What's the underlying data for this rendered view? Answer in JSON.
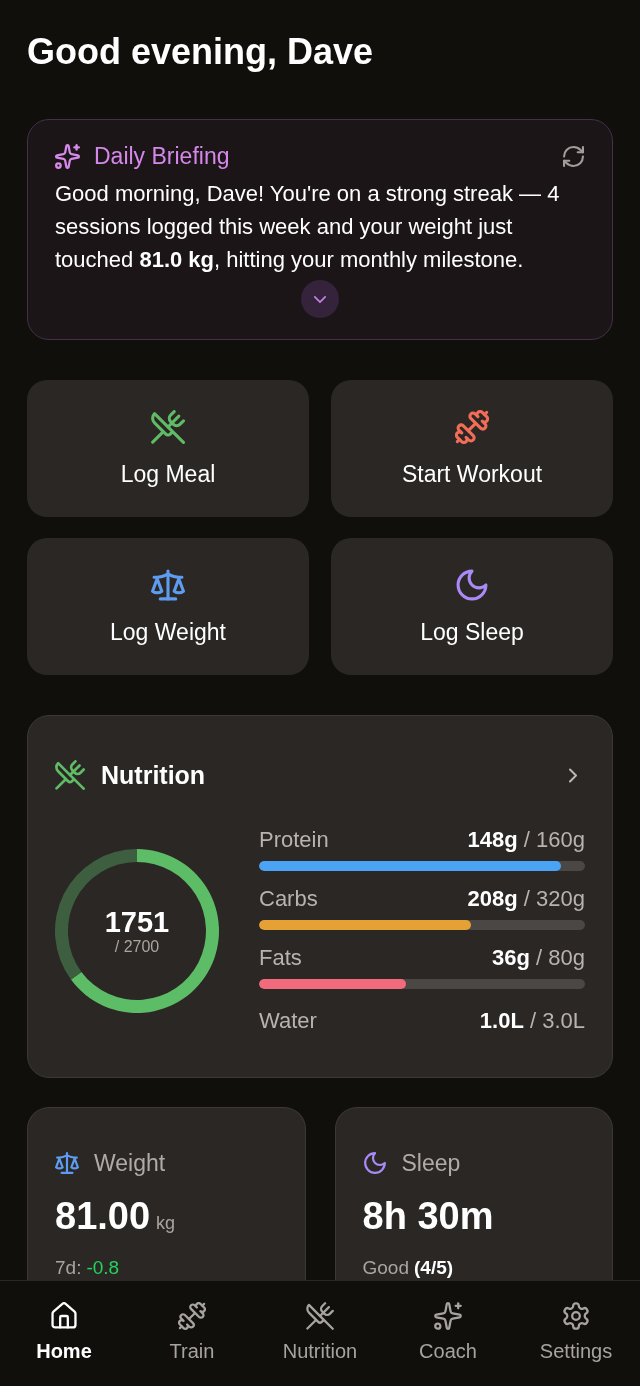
{
  "greeting": "Good evening, Dave",
  "briefing": {
    "title": "Daily Briefing",
    "text": "Good morning, Dave! You're on a strong streak — 4 sessions logged this week and your weight just touched **81.0 kg**, hitting your monthly milestone.",
    "expanded": false
  },
  "quick_actions": [
    {
      "kind": "meal",
      "label": "Log Meal"
    },
    {
      "kind": "workout",
      "label": "Start Workout"
    },
    {
      "kind": "weight",
      "label": "Log Weight"
    },
    {
      "kind": "sleep",
      "label": "Log Sleep"
    }
  ],
  "nutrition": {
    "title": "Nutrition",
    "calories": {
      "value": "1751",
      "goal": "/ 2700",
      "chart_data": {
        "type": "donut",
        "values": [
          64.9,
          35.1
        ]
      }
    },
    "macros": [
      {
        "name": "Protein",
        "amount": "**148g** / 160g",
        "level": 0.925,
        "color": "#4ba3f5"
      },
      {
        "name": "Carbs",
        "amount": "**208g** / 320g",
        "level": 0.65,
        "color": "#e6a135"
      },
      {
        "name": "Fats",
        "amount": "**36g** / 80g",
        "level": 0.45,
        "color": "#f26b7c"
      },
      {
        "name": "Water",
        "amount": "**1.0L** / 3.0L"
      }
    ]
  },
  "stats": [
    {
      "kind": "weight",
      "label": "Weight",
      "value": "81.00",
      "unit": "kg",
      "note": "7d:",
      "change": "-0.8"
    },
    {
      "kind": "sleep",
      "label": "Sleep",
      "value": "8h 30m",
      "note": "Good",
      "rating": "(4/5)"
    }
  ],
  "nav": [
    {
      "kind": "home",
      "label": "Home",
      "selected": true
    },
    {
      "kind": "train",
      "label": "Train",
      "selected": false
    },
    {
      "kind": "nutrition",
      "label": "Nutrition",
      "selected": false
    },
    {
      "kind": "coach",
      "label": "Coach",
      "selected": false
    },
    {
      "kind": "settings",
      "label": "Settings",
      "selected": false
    }
  ]
}
